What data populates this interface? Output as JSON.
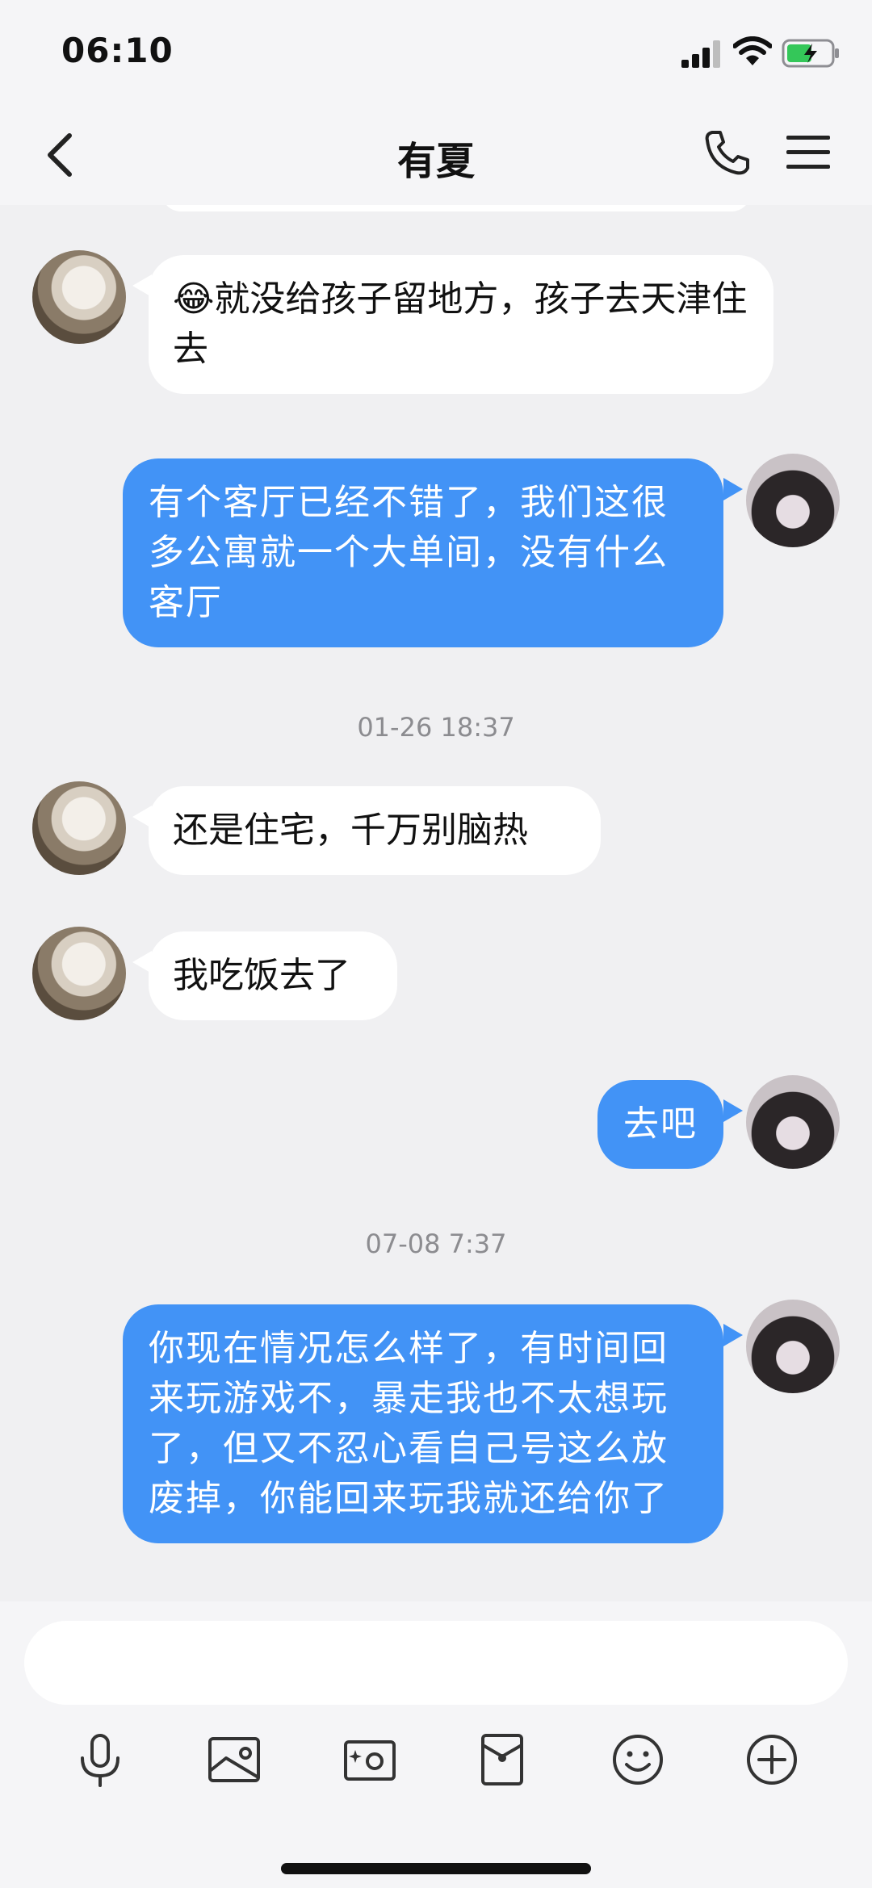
{
  "status": {
    "time": "06:10"
  },
  "header": {
    "title": "有夏"
  },
  "messages": [
    {
      "side": "in",
      "text": "😂就没给孩子留地方，孩子去天津住去"
    },
    {
      "side": "out",
      "text": "有个客厅已经不错了，我们这很多公寓就一个大单间，没有什么客厅"
    },
    {
      "side": "in",
      "text": "还是住宅，千万别脑热"
    },
    {
      "side": "in",
      "text": "我吃饭去了"
    },
    {
      "side": "out",
      "text": "去吧"
    },
    {
      "side": "out",
      "text": "你现在情况怎么样了，有时间回来玩游戏不，暴走我也不太想玩了，但又不忍心看自己号这么放废掉，你能回来玩我就还给你了"
    }
  ],
  "timestamps": [
    "01-26 18:37",
    "07-08 7:37"
  ],
  "input": {
    "placeholder": ""
  },
  "toolbar": [
    "microphone-icon",
    "image-icon",
    "camera-icon",
    "red-envelope-icon",
    "emoji-icon",
    "plus-icon"
  ],
  "colors": {
    "outgoing_bubble": "#4293f6",
    "incoming_bubble": "#ffffff",
    "background": "#f0f0f2"
  }
}
